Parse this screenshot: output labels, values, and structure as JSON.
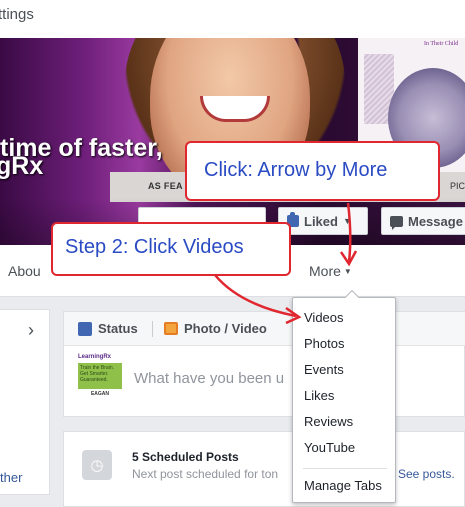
{
  "topbar": {
    "settings_fragment": "ttings"
  },
  "cover": {
    "text_line1": "time of faster,",
    "text_line2": "gRx",
    "strip_left": "AS FEA",
    "strip_right": "PIC",
    "card_label": "In Their Child"
  },
  "actions": {
    "liked_label": "Liked",
    "message_label": "Message"
  },
  "nav": {
    "about_label": "Abou",
    "more_label": "More"
  },
  "feed": {
    "left_fragment": "ther",
    "composer": {
      "tab_status": "Status",
      "tab_photo": "Photo / Video",
      "placeholder": "What have you been u",
      "avatar_brand": "LearningRx",
      "avatar_tagline": "Train the Brain. Get Smarter. Guaranteed.",
      "avatar_city": "EAGAN"
    },
    "scheduled": {
      "title": "5 Scheduled Posts",
      "subtitle": "Next post scheduled for ton",
      "link": "See posts."
    }
  },
  "menu": {
    "items": [
      "Videos",
      "Photos",
      "Events",
      "Likes",
      "Reviews",
      "YouTube"
    ],
    "footer_item": "Manage Tabs"
  },
  "annotations": {
    "callout_more": "Click: Arrow by More",
    "callout_step2": "Step 2: Click Videos",
    "color": "#e0262e",
    "text_color": "#2a4bc3"
  }
}
